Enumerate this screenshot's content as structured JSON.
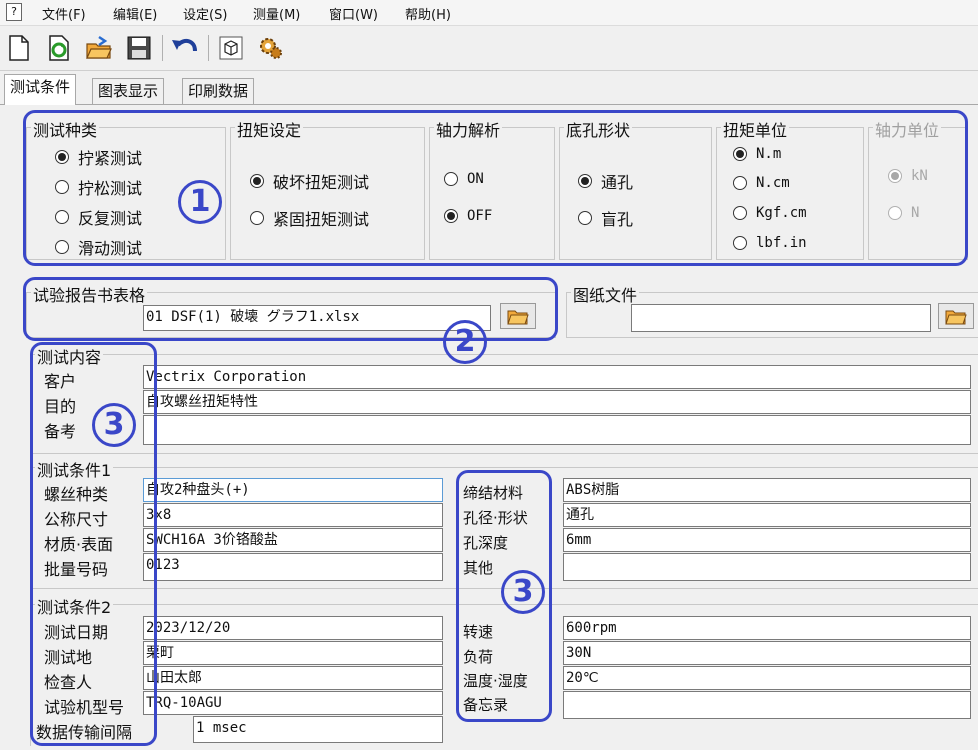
{
  "menu": {
    "items": [
      "文件(F)",
      "编辑(E)",
      "设定(S)",
      "测量(M)",
      "窗口(W)",
      "帮助(H)"
    ]
  },
  "toolbar": {
    "icons": [
      "new-file-icon",
      "refresh-icon",
      "open-folder-icon",
      "save-icon",
      "undo-icon",
      "cube-icon",
      "gear-icon"
    ]
  },
  "tabs": [
    "测试条件",
    "图表显示",
    "印刷数据"
  ],
  "test_type": {
    "title": "测试种类",
    "options": [
      "拧紧测试",
      "拧松测试",
      "反复测试",
      "滑动测试"
    ]
  },
  "torque_setting": {
    "title": "扭矩设定",
    "options": [
      "破坏扭矩测试",
      "紧固扭矩测试"
    ]
  },
  "axial_analysis": {
    "title": "轴力解析",
    "options": [
      "ON",
      "OFF"
    ]
  },
  "hole_shape": {
    "title": "底孔形状",
    "options": [
      "通孔",
      "盲孔"
    ]
  },
  "torque_unit": {
    "title": "扭矩单位",
    "options": [
      "N.m",
      "N.cm",
      "Kgf.cm",
      "lbf.in"
    ]
  },
  "axial_unit": {
    "title": "轴力单位",
    "options": [
      "kN",
      "N"
    ]
  },
  "report": {
    "title": "试验报告书表格",
    "file": "01 DSF(1) 破壊 グラフ1.xlsx"
  },
  "drawing": {
    "title": "图纸文件",
    "file": ""
  },
  "content": {
    "title": "测试内容",
    "customer_label": "客户",
    "customer": "Vectrix Corporation",
    "purpose_label": "目的",
    "purpose": "自攻螺丝扭矩特性",
    "notes_label": "备考",
    "notes": ""
  },
  "cond1": {
    "title": "测试条件1",
    "screw_type_label": "螺丝种类",
    "screw_type": "自攻2种盘头(+)",
    "size_label": "公称尺寸",
    "size": "3x8",
    "material_label": "材质·表面",
    "material": "SWCH16A 3价铬酸盐",
    "lot_label": "批量号码",
    "lot": "0123",
    "fasten_label": "缔结材料",
    "fasten": "ABS树脂",
    "hole_label": "孔径·形状",
    "hole": "通孔",
    "depth_label": "孔深度",
    "depth": "6mm",
    "other_label": "其他",
    "other": ""
  },
  "cond2": {
    "title": "测试条件2",
    "date_label": "测试日期",
    "date": "2023/12/20",
    "place_label": "测试地",
    "place": "栗町",
    "inspector_label": "检查人",
    "inspector": "山田太郎",
    "machine_label": "试验机型号",
    "machine": "TRQ-10AGU",
    "interval_label": "数据传输间隔",
    "interval": "1 msec",
    "speed_label": "转速",
    "speed": "600rpm",
    "load_label": "负荷",
    "load": "30N",
    "temp_label": "温度·湿度",
    "temp": "20℃",
    "memo_label": "备忘录",
    "memo": ""
  },
  "annotations": [
    "1",
    "2",
    "3",
    "3",
    "3"
  ],
  "colors": {
    "annotation": "#3a47c8",
    "focus_border": "#5b9bd5"
  }
}
